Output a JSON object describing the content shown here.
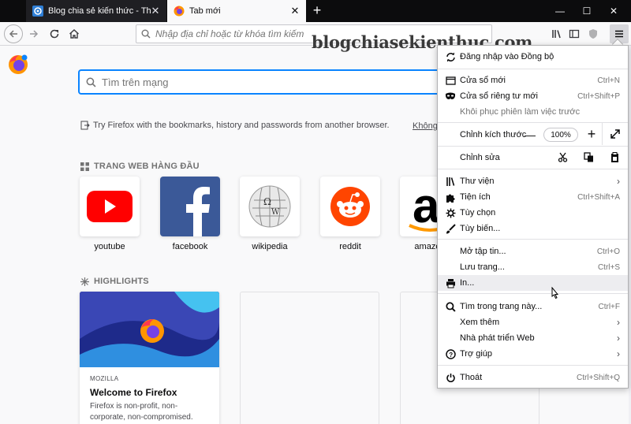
{
  "tabs": [
    {
      "label": "Blog chia sẻ kiến thức - Thủ thuật",
      "active": false
    },
    {
      "label": "Tab mới",
      "active": true
    }
  ],
  "new_tab_symbol": "+",
  "window_controls": {
    "minimize": "—",
    "maximize": "☐",
    "close": "✕"
  },
  "urlbar": {
    "placeholder": "Nhập địa chỉ hoặc từ khóa tìm kiếm"
  },
  "watermark": "blogchiasekienthuc.com",
  "newtab": {
    "search_placeholder": "Tìm trên mạng",
    "import_text": "Try Firefox with the bookmarks, history and passwords from another browser.",
    "import_link": "Không",
    "top_sites_title": "TRANG WEB HÀNG ĐẦU",
    "top_sites": [
      {
        "label": "youtube",
        "icon": "youtube-icon"
      },
      {
        "label": "facebook",
        "icon": "facebook-icon"
      },
      {
        "label": "wikipedia",
        "icon": "wikipedia-icon"
      },
      {
        "label": "reddit",
        "icon": "reddit-icon"
      },
      {
        "label": "amazon",
        "icon": "amazon-icon"
      }
    ],
    "highlights_title": "HIGHLIGHTS",
    "highlight": {
      "source": "MOZILLA",
      "title": "Welcome to Firefox",
      "description": "Firefox is non-profit, non-corporate, non-compromised. Choosing"
    }
  },
  "menu": {
    "sync": "Đăng nhập vào Đồng bộ",
    "new_window": {
      "label": "Cửa sổ mới",
      "shortcut": "Ctrl+N"
    },
    "private_window": {
      "label": "Cửa sổ riêng tư mới",
      "shortcut": "Ctrl+Shift+P"
    },
    "restore": "Khôi phục phiên làm việc trước",
    "zoom": {
      "label": "Chỉnh kích thước",
      "minus": "—",
      "value": "100%",
      "plus": "+"
    },
    "edit": {
      "label": "Chỉnh sửa"
    },
    "library": "Thư viện",
    "addons": {
      "label": "Tiện ích",
      "shortcut": "Ctrl+Shift+A"
    },
    "options": "Tùy chọn",
    "customize": "Tùy biến...",
    "open_file": {
      "label": "Mở tập tin...",
      "shortcut": "Ctrl+O"
    },
    "save_page": {
      "label": "Lưu trang...",
      "shortcut": "Ctrl+S"
    },
    "print": "In...",
    "find": {
      "label": "Tìm trong trang này...",
      "shortcut": "Ctrl+F"
    },
    "more": "Xem thêm",
    "web_dev": "Nhà phát triển Web",
    "help": "Trợ giúp",
    "quit": {
      "label": "Thoát",
      "shortcut": "Ctrl+Shift+Q"
    },
    "submenu_arrow": "›"
  },
  "colors": {
    "accent": "#0a84ff",
    "tabbar": "#0c0c0d",
    "youtube": "#ff0000",
    "facebook": "#3b5998",
    "reddit": "#ff4500"
  }
}
